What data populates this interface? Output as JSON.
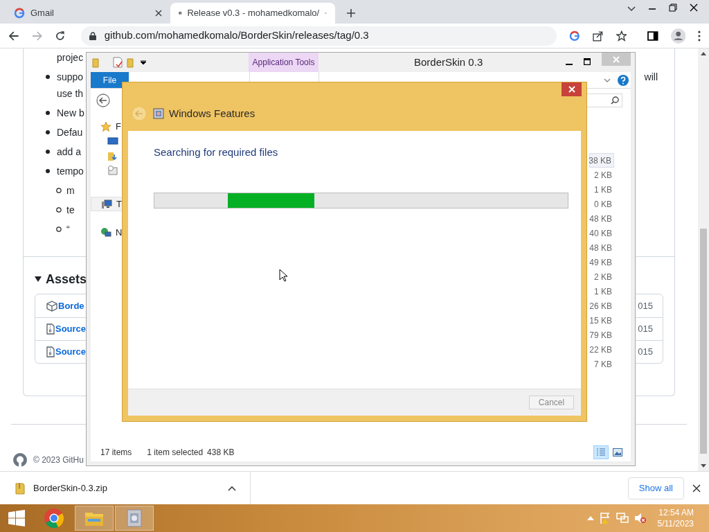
{
  "browser": {
    "tabs": [
      {
        "title": "Gmail",
        "kind": "google",
        "selected": false
      },
      {
        "title": "Release v0.3 - mohamedkomalo/",
        "kind": "github",
        "selected": true
      }
    ],
    "url": "github.com/mohamedkomalo/BorderSkin/releases/tag/0.3"
  },
  "page": {
    "notes": [
      {
        "kind": "line",
        "text": "projec"
      },
      {
        "kind": "bullet",
        "text": "suppo",
        "tail": "will"
      },
      {
        "kind": "line",
        "text": "use th"
      },
      {
        "kind": "bullet",
        "text": "New b"
      },
      {
        "kind": "bullet",
        "text": "Defau"
      },
      {
        "kind": "bullet",
        "text": "add a"
      },
      {
        "kind": "bullet",
        "text": "tempo"
      },
      {
        "kind": "sub",
        "text": "m"
      },
      {
        "kind": "sub",
        "text": "te"
      },
      {
        "kind": "sub",
        "text": "“"
      }
    ],
    "assets": {
      "title": "Assets",
      "expanded": true,
      "rows": [
        {
          "kind": "package",
          "name": "Borde",
          "date": "015"
        },
        {
          "kind": "zip",
          "name": "Source",
          "date": "015"
        },
        {
          "kind": "zip",
          "name": "Source",
          "date": "015"
        }
      ]
    },
    "footer": "© 2023 GitHu"
  },
  "explorer": {
    "title": "BorderSkin 0.3",
    "context_tab": "Application Tools",
    "ribbon_tabs": [
      {
        "label": "File",
        "kind": "file"
      }
    ],
    "nav": [
      {
        "kind": "favorites",
        "label": "F"
      },
      {
        "kind": "desktop"
      },
      {
        "kind": "downloads"
      },
      {
        "kind": "recent"
      },
      {
        "kind": "pc",
        "label": "T",
        "selected": true
      },
      {
        "kind": "network",
        "label": "N",
        "selected": false
      }
    ],
    "sizes": [
      {
        "size": "38 KB",
        "selected": true
      },
      {
        "size": "2 KB",
        "selected": false
      },
      {
        "size": "1 KB",
        "selected": false
      },
      {
        "size": "0 KB",
        "selected": false
      },
      {
        "size": "48 KB",
        "selected": false
      },
      {
        "size": "40 KB",
        "selected": false
      },
      {
        "size": "48 KB",
        "selected": false
      },
      {
        "size": "49 KB",
        "selected": false
      },
      {
        "size": "2 KB",
        "selected": false
      },
      {
        "size": "1 KB",
        "selected": false
      },
      {
        "size": "26 KB",
        "selected": false
      },
      {
        "size": "15 KB",
        "selected": false
      },
      {
        "size": "79 KB",
        "selected": false
      },
      {
        "size": "22 KB",
        "selected": false
      },
      {
        "size": "7 KB",
        "selected": false
      }
    ],
    "status": {
      "count": "17 items",
      "selection": "1 item selected",
      "size": "438 KB"
    },
    "views": [
      {
        "kind": "details",
        "selected": true
      },
      {
        "kind": "large",
        "selected": false
      }
    ]
  },
  "dialog": {
    "title": "Windows Features",
    "message": "Searching for required files",
    "progress": {
      "level": 0.21
    },
    "cancel": {
      "label": "Cancel",
      "disabled": true
    }
  },
  "download": {
    "file": "BorderSkin-0.3.zip",
    "show_all": "Show all"
  },
  "taskbar": {
    "apps": [
      {
        "kind": "chrome",
        "active": false
      },
      {
        "kind": "explorer",
        "active": true
      },
      {
        "kind": "features",
        "active": true
      }
    ],
    "time": "12:54 AM",
    "date": "5/11/2023",
    "muted": true
  }
}
